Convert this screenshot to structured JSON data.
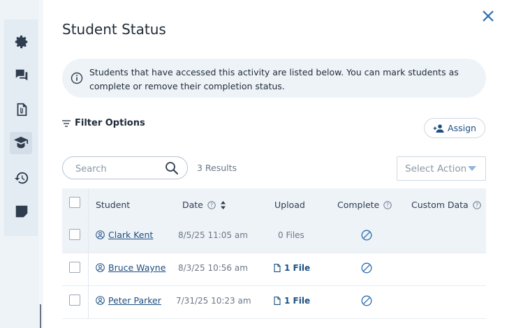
{
  "sidebar": {
    "icons": [
      "gear-icon",
      "chat-bubbles-icon",
      "attachment-document-icon",
      "graduation-student-icon",
      "history-icon",
      "note-icon"
    ],
    "active": "graduation-student-icon"
  },
  "panel": {
    "title": "Student Status",
    "info_text": "Students that have accessed this activity are listed below. You can mark students as complete or remove their completion status.",
    "filter_label": "Filter Options",
    "assign_label": "Assign",
    "search_placeholder": "Search",
    "results_text": "3 Results",
    "select_action_label": "Select Action"
  },
  "table": {
    "headers": {
      "student": "Student",
      "date": "Date",
      "upload": "Upload",
      "complete": "Complete",
      "custom_data": "Custom Data"
    },
    "rows": [
      {
        "name": "Clark Kent",
        "date": "8/5/25 11:05 am",
        "upload": "0 Files",
        "has_file": false
      },
      {
        "name": "Bruce Wayne",
        "date": "8/3/25 10:56 am",
        "upload": "1 File",
        "has_file": true
      },
      {
        "name": "Peter Parker",
        "date": "7/31/25 10:23 am",
        "upload": "1 File",
        "has_file": true
      }
    ]
  },
  "colors": {
    "accent": "#1c4e80",
    "close": "#2b6cb0",
    "panel_bg": "#eef3f8"
  }
}
